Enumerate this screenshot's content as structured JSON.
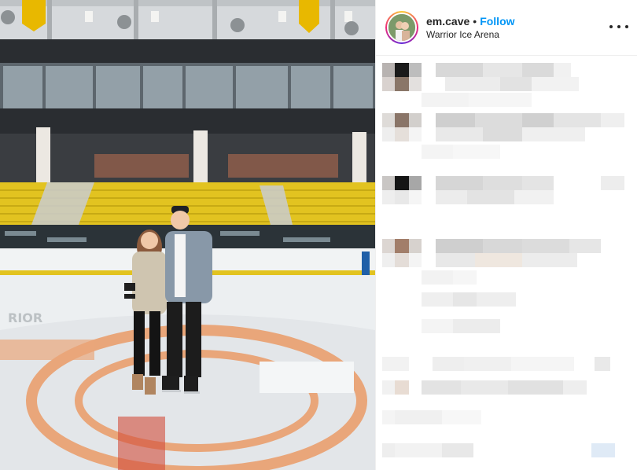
{
  "post": {
    "username": "em.cave",
    "separator": "•",
    "follow_label": "Follow",
    "location": "Warrior Ice Arena",
    "more_icon": "more-options-icon"
  },
  "photo": {
    "icon": "photo",
    "description_icon": "ice-rink-photo-icon"
  },
  "comments": {
    "state": "pixelated"
  },
  "colors": {
    "link": "#0095f6",
    "text": "#262626",
    "divider": "#efefef"
  }
}
